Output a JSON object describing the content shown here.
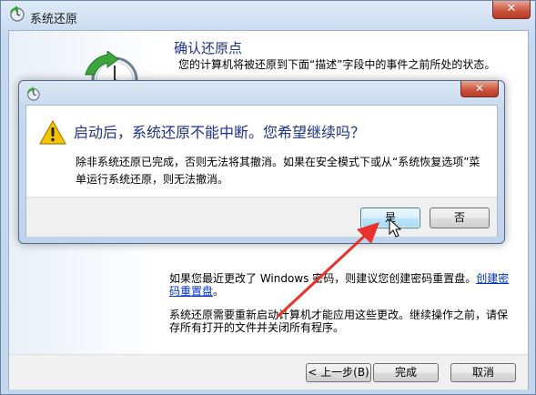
{
  "window": {
    "title": "系统还原",
    "close_glyph": "✕",
    "heading": "确认还原点",
    "description": "您的计算机将被还原到下面“描述”字段中的事件之前所处的状态。",
    "note_password_prefix": "如果您最近更改了 Windows 密码，则建议您创建密码重置盘。",
    "note_password_link": "创建密码重置盘",
    "note_password_suffix": "。",
    "note_restart": "系统还原需要重新启动计算机才能应用这些更改。继续操作之前，请保存所有打开的文件并关闭所有程序。",
    "buttons": {
      "back": "< 上一步(B)",
      "finish": "完成",
      "cancel": "取消"
    }
  },
  "dialog": {
    "close_glyph": "✕",
    "heading": "启动后，系统还原不能中断。您希望继续吗？",
    "message": "除非系统还原已完成，否则无法将其撤消。如果在安全模式下或从“系统恢复选项”菜单运行系统还原，则无法撤消。",
    "buttons": {
      "yes": "是",
      "no": "否"
    }
  },
  "icons": {
    "window_icon": "system-restore-icon",
    "dialog_icon": "system-restore-icon",
    "warning": "warning-icon",
    "cursor": "mouse-pointer-icon"
  },
  "colors": {
    "heading_blue": "#1e3287",
    "link_blue": "#0033cc",
    "annotation_red": "#e8322b",
    "warning_yellow": "#f5c400"
  }
}
